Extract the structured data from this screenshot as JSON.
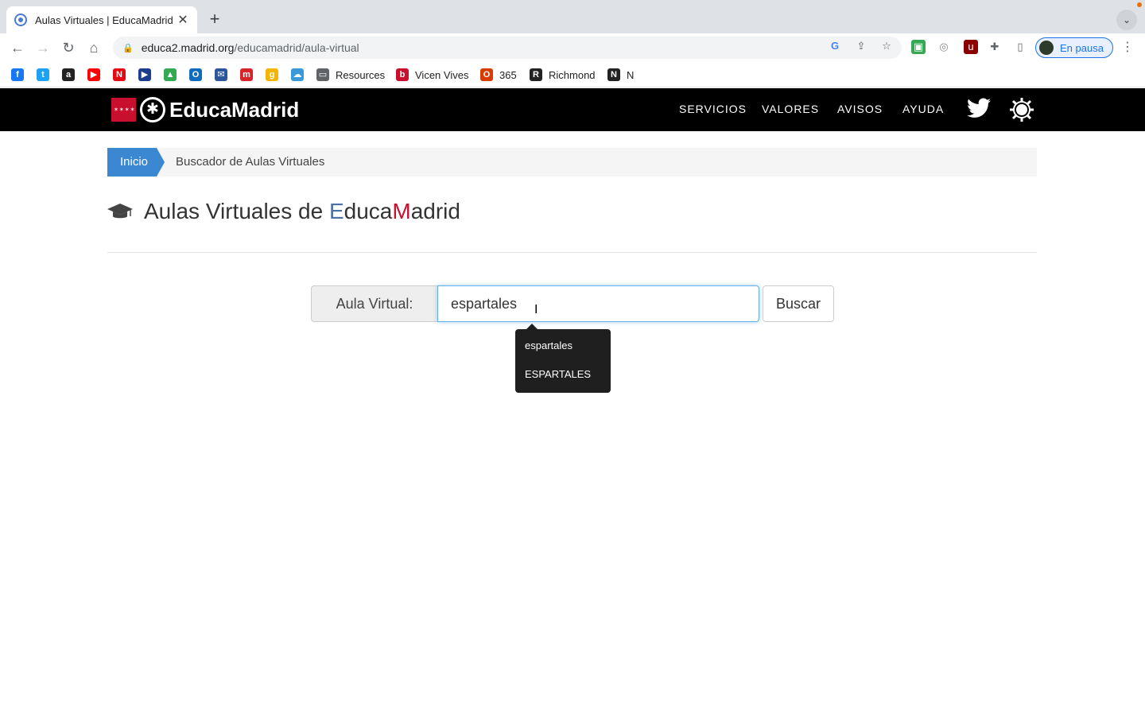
{
  "browser": {
    "tab_title": "Aulas Virtuales | EducaMadrid",
    "tab_close": "✕",
    "new_tab": "+",
    "tab_search": "⌄",
    "url_host": "educa2.madrid.org",
    "url_path": "/educamadrid/aula-virtual",
    "profile_label": "En pausa",
    "menu": "⋮"
  },
  "bookmarks": [
    {
      "icon": "facebook-icon",
      "label": "",
      "color": "#1877f2",
      "glyph": "f"
    },
    {
      "icon": "twitter-icon",
      "label": "",
      "color": "#1da1f2",
      "glyph": "t"
    },
    {
      "icon": "amazon-icon",
      "label": "",
      "color": "#222222",
      "glyph": "a"
    },
    {
      "icon": "youtube-icon",
      "label": "",
      "color": "#ff0000",
      "glyph": "▶"
    },
    {
      "icon": "netflix-icon",
      "label": "",
      "color": "#e50914",
      "glyph": "N"
    },
    {
      "icon": "play-icon",
      "label": "",
      "color": "#1a3e8c",
      "glyph": "▶"
    },
    {
      "icon": "drive-icon",
      "label": "",
      "color": "#34a853",
      "glyph": "▲"
    },
    {
      "icon": "outlook-icon",
      "label": "",
      "color": "#0f6cbd",
      "glyph": "O"
    },
    {
      "icon": "mail-icon",
      "label": "",
      "color": "#2b579a",
      "glyph": "✉"
    },
    {
      "icon": "m-icon",
      "label": "",
      "color": "#d8232a",
      "glyph": "m"
    },
    {
      "icon": "g-icon",
      "label": "",
      "color": "#f4b400",
      "glyph": "g"
    },
    {
      "icon": "cloud-icon",
      "label": "",
      "color": "#3a9ad9",
      "glyph": "☁"
    },
    {
      "icon": "folder-icon",
      "label": "Resources",
      "color": "#5f6368",
      "glyph": "▭"
    },
    {
      "icon": "vicens-vives-icon",
      "label": "Vicen Vives",
      "color": "#c8102e",
      "glyph": "b"
    },
    {
      "icon": "office-icon",
      "label": "365",
      "color": "#d83b01",
      "glyph": "O"
    },
    {
      "icon": "richmond-icon",
      "label": "Richmond",
      "color": "#222222",
      "glyph": "R"
    },
    {
      "icon": "notion-icon",
      "label": "N",
      "color": "#222222",
      "glyph": "N"
    }
  ],
  "site": {
    "flag_stars": "✶✶✶✶",
    "logo_text": "EducaMadrid",
    "nav": [
      "SERVICIOS",
      "VALORES",
      "AVISOS",
      "AYUDA"
    ],
    "twitter_glyph": "🐦"
  },
  "breadcrumb": {
    "home": "Inicio",
    "current": "Buscador de Aulas Virtuales"
  },
  "title": {
    "prefix": "Aulas Virtuales de ",
    "e": "E",
    "duca": "duca",
    "m": "M",
    "adrid": "adrid"
  },
  "search": {
    "addon_label": "Aula Virtual:",
    "value": "espartales",
    "button": "Buscar",
    "suggestions": [
      "espartales",
      "ESPARTALES"
    ]
  },
  "colors": {
    "header_bg": "#000000",
    "accent_blue": "#3b87d1",
    "brand_red": "#c8102e"
  }
}
